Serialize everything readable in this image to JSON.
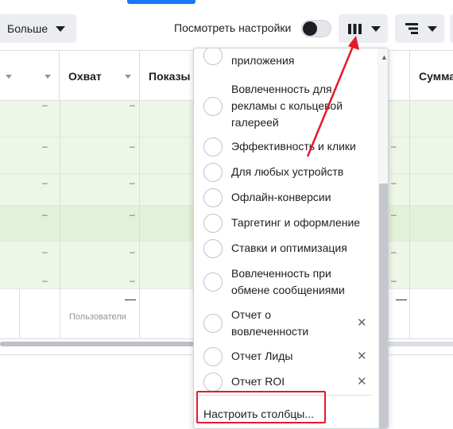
{
  "toolbar": {
    "more_label": "Больше",
    "view_settings_label": "Посмотреть настройки",
    "view_settings_on": false
  },
  "table": {
    "columns": [
      {
        "label": ""
      },
      {
        "label": "Охват"
      },
      {
        "label": "Показы"
      },
      {
        "label": "Сумма"
      }
    ],
    "dash": "–",
    "total_reach_dash": "—",
    "total_dash": "—",
    "reach_subtitle": "Пользователи"
  },
  "menu": {
    "items": [
      {
        "label": "приложения",
        "removable": false
      },
      {
        "label": "Вовлеченность для рекламы с кольцевой галереей",
        "removable": false
      },
      {
        "label": "Эффективность и клики",
        "removable": false
      },
      {
        "label": "Для любых устройств",
        "removable": false
      },
      {
        "label": "Офлайн-конверсии",
        "removable": false
      },
      {
        "label": "Таргетинг и оформление",
        "removable": false
      },
      {
        "label": "Ставки и оптимизация",
        "removable": false
      },
      {
        "label": "Вовлеченность при обмене сообщениями",
        "removable": false
      },
      {
        "label": "Отчет о вовлеченности",
        "removable": true
      },
      {
        "label": "Отчет Лиды",
        "removable": true
      },
      {
        "label": "Отчет ROI",
        "removable": true
      }
    ],
    "remove_symbol": "✕",
    "customize_label": "Настроить столбцы..."
  },
  "colors": {
    "row_green": "#eef6e8",
    "row_green_strong": "#e2f1d8",
    "annotation_red": "#e4192a"
  }
}
